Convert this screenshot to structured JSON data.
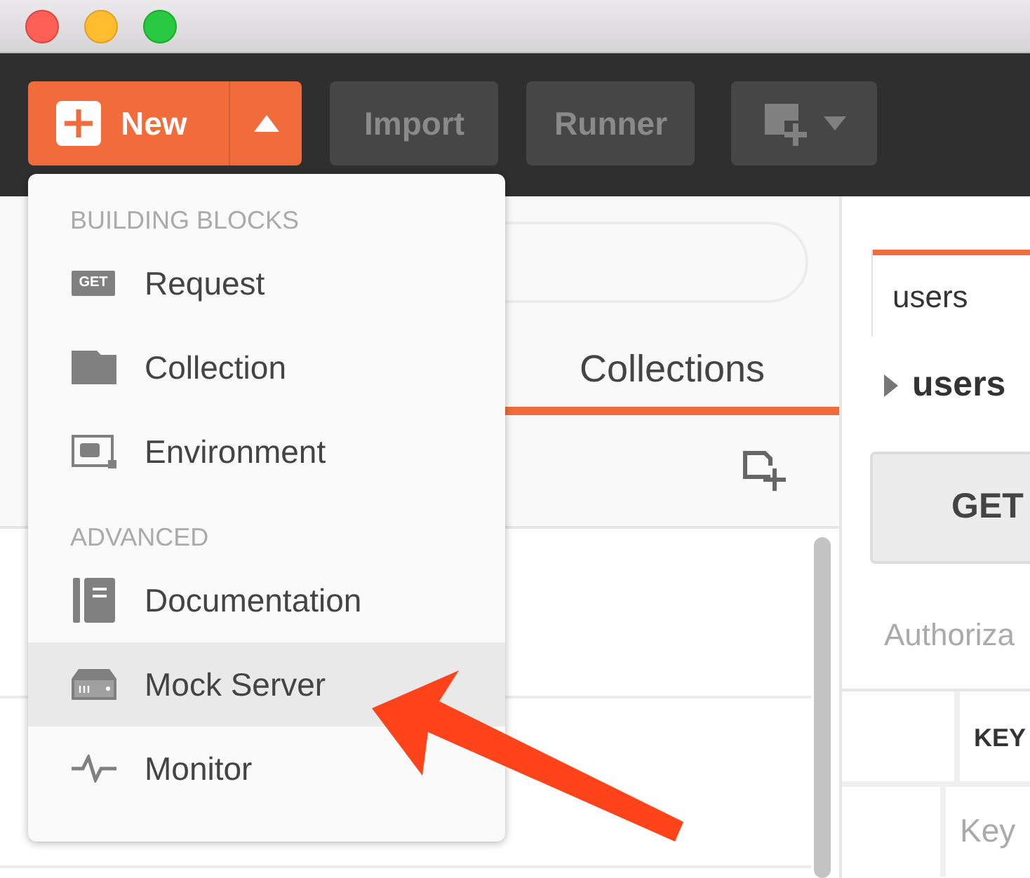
{
  "toolbar": {
    "new_button": {
      "label": "New"
    },
    "buttons": [
      {
        "label": "Import"
      },
      {
        "label": "Runner"
      }
    ]
  },
  "sidebar": {
    "tabs": [
      {
        "label": "Collections",
        "selected": true
      }
    ]
  },
  "new_menu": {
    "sections": [
      {
        "header": "BUILDING BLOCKS",
        "items": [
          {
            "kind": "request",
            "badge": "GET",
            "label": "Request",
            "selected": false
          },
          {
            "kind": "collection",
            "label": "Collection",
            "selected": false
          },
          {
            "kind": "environment",
            "label": "Environment",
            "selected": false
          }
        ]
      },
      {
        "header": "ADVANCED",
        "items": [
          {
            "kind": "documentation",
            "label": "Documentation",
            "selected": false
          },
          {
            "kind": "mock",
            "label": "Mock Server",
            "selected": true
          },
          {
            "kind": "monitor",
            "label": "Monitor",
            "selected": false
          }
        ]
      }
    ]
  },
  "request": {
    "tabs": [
      {
        "label": "users",
        "selected": true
      }
    ],
    "name": "users",
    "method": "GET",
    "section_tab": "Authoriza",
    "table": {
      "header": "KEY",
      "placeholder": "Key"
    }
  }
}
